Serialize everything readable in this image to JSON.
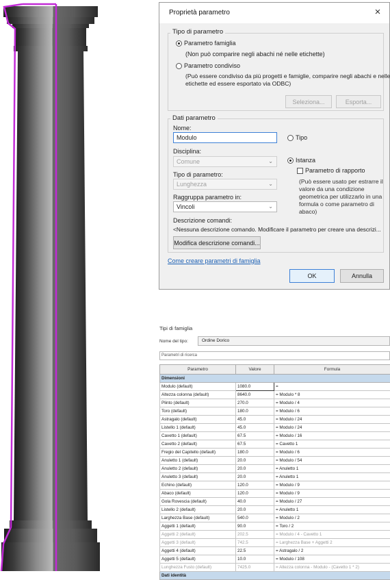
{
  "param_dialog": {
    "title": "Proprietà parametro",
    "close_glyph": "×",
    "tipo_group": {
      "label": "Tipo di parametro",
      "famiglia_label": "Parametro famiglia",
      "famiglia_desc": "(Non può comparire negli abachi né nelle etichette)",
      "condiviso_label": "Parametro condiviso",
      "condiviso_desc_1": "(Può essere condiviso da più progetti e famiglie, comparire negli abachi e nelle",
      "condiviso_desc_2": "etichette ed essere esportato via ODBC)",
      "seleziona_label": "Seleziona...",
      "esporta_label": "Esporta..."
    },
    "dati_group": {
      "label": "Dati parametro",
      "nome_label": "Nome:",
      "nome_value": "Modulo",
      "tipo_option": "Tipo",
      "istanza_option": "Istanza",
      "rapporto_label": "Parametro di rapporto",
      "rapporto_desc": "(Può essere usato per estrarre il valore da una condizione geometrica per utilizzarlo in una formula o come parametro di abaco)",
      "disciplina_label": "Disciplina:",
      "disciplina_value": "Comune",
      "tipo_param_label": "Tipo di parametro:",
      "tipo_param_value": "Lunghezza",
      "raggruppa_label": "Raggruppa parametro in:",
      "raggruppa_value": "Vincoli",
      "descr_label": "Descrizione comandi:",
      "descr_text": "<Nessuna descrizione comando. Modificare il parametro per creare una descrizi...",
      "modifica_label": "Modifica descrizione comandi..."
    },
    "help_link": "Come creare parametri di famiglia",
    "ok_label": "OK",
    "annulla_label": "Annulla"
  },
  "types_dialog": {
    "title": "Tipi di famiglia",
    "name_label": "Nome del tipo:",
    "name_value": "Ordine Dorico",
    "search_placeholder": "Parametri di ricerca",
    "headers": [
      "Parametro",
      "Valore",
      "Formula"
    ],
    "group_dimensioni": "Dimensioni",
    "group_identita": "Dati identità",
    "rows": [
      {
        "p": "Modulo (default)",
        "v": "1080.0",
        "f": "="
      },
      {
        "p": "Altezza colonna (default)",
        "v": "8640.0",
        "f": "= Modulo * 8"
      },
      {
        "p": "Plinto (default)",
        "v": "270.0",
        "f": "= Modulo / 4"
      },
      {
        "p": "Toro (default)",
        "v": "180.0",
        "f": "= Modulo / 6"
      },
      {
        "p": "Astragalo (default)",
        "v": "45.0",
        "f": "= Modulo / 24"
      },
      {
        "p": "Listello 1 (default)",
        "v": "45.0",
        "f": "= Modulo / 24"
      },
      {
        "p": "Cavetto 1 (default)",
        "v": "67.5",
        "f": "= Modulo / 16"
      },
      {
        "p": "Cavetto 2 (default)",
        "v": "67.5",
        "f": "= Cavetto 1"
      },
      {
        "p": "Fregio del Capitello (default)",
        "v": "180.0",
        "f": "= Modulo / 6"
      },
      {
        "p": "Anuletto 1 (default)",
        "v": "20.0",
        "f": "= Modulo / 54"
      },
      {
        "p": "Anuletto 2 (default)",
        "v": "20.0",
        "f": "= Anuletto 1"
      },
      {
        "p": "Anuletto 3 (default)",
        "v": "20.0",
        "f": "= Anuletto 1"
      },
      {
        "p": "Echino (default)",
        "v": "120.0",
        "f": "= Modulo / 9"
      },
      {
        "p": "Abaco (default)",
        "v": "120.0",
        "f": "= Modulo / 9"
      },
      {
        "p": "Gola Rovescia (default)",
        "v": "40.0",
        "f": "= Modulo / 27"
      },
      {
        "p": "Listello 2 (default)",
        "v": "20.0",
        "f": "= Anuletto 1"
      },
      {
        "p": "Larghezza Base (default)",
        "v": "540.0",
        "f": "= Modulo / 2"
      },
      {
        "p": "Aggetti 1 (default)",
        "v": "90.0",
        "f": "= Toro / 2"
      },
      {
        "p": "Aggetti 2 (default)",
        "v": "202.5",
        "f": "= Modulo / 4 - Cavetto 1"
      },
      {
        "p": "Aggetti 3 (default)",
        "v": "742.5",
        "f": "= Larghezza Base + Aggetti 2"
      },
      {
        "p": "Aggetti 4 (default)",
        "v": "22.5",
        "f": "= Astragalo / 2"
      },
      {
        "p": "Aggetti 5 (default)",
        "v": "10.0",
        "f": "= Modulo / 108"
      },
      {
        "p": "Lunghezza Fusto (default)",
        "v": "7425.0",
        "f": "= Altezza colonna - Modulo - (Cavetto 1 * 2)"
      }
    ]
  },
  "colors": {
    "selection_outline": "#c12bd6",
    "link": "#1a5fb4",
    "group_header": "#c5d9ec"
  }
}
